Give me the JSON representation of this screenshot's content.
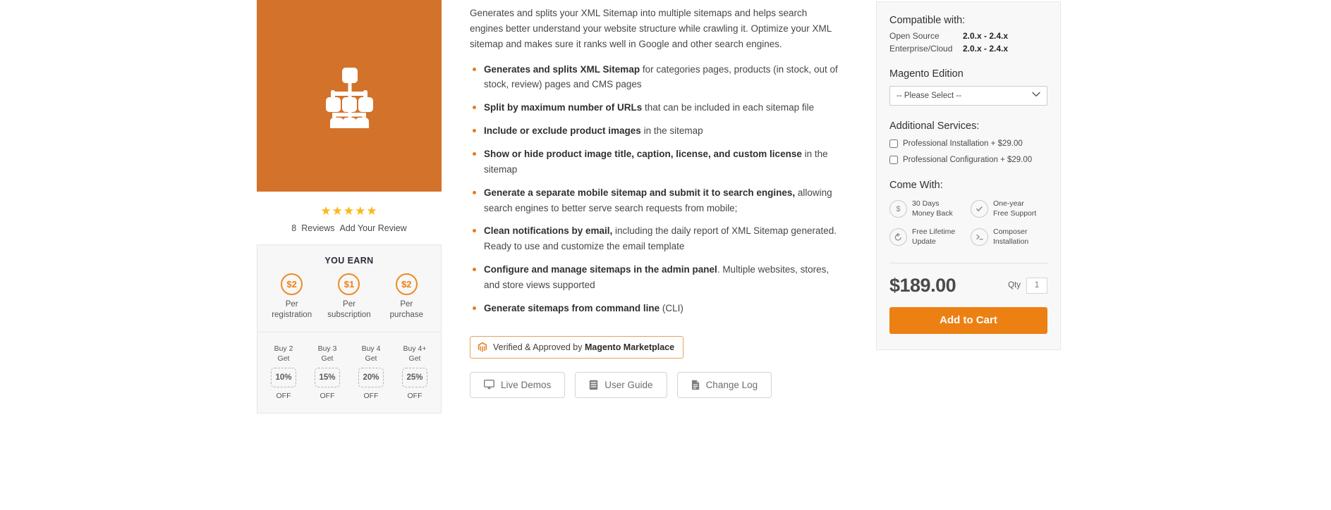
{
  "product": {
    "image_alt": "sitemap-tree-graphic",
    "image_bg": "#d3722a",
    "rating": {
      "stars_filled": 5,
      "stars_total": 5,
      "star_glyph": "★",
      "count_label": "8",
      "reviews_label": "Reviews",
      "add_review_label": "Add Your Review"
    }
  },
  "earn": {
    "title": "YOU EARN",
    "items": [
      {
        "amount": "$2",
        "line1": "Per",
        "line2": "registration"
      },
      {
        "amount": "$1",
        "line1": "Per",
        "line2": "subscription"
      },
      {
        "amount": "$2",
        "line1": "Per",
        "line2": "purchase"
      }
    ],
    "tiers": [
      {
        "buy": "Buy 2",
        "get": "Get",
        "percent": "10%",
        "off": "OFF"
      },
      {
        "buy": "Buy 3",
        "get": "Get",
        "percent": "15%",
        "off": "OFF"
      },
      {
        "buy": "Buy 4",
        "get": "Get",
        "percent": "20%",
        "off": "OFF"
      },
      {
        "buy": "Buy 4+",
        "get": "Get",
        "percent": "25%",
        "off": "OFF"
      }
    ]
  },
  "description": {
    "intro": "Generates and splits your XML Sitemap into multiple sitemaps and helps search engines better understand your website structure while crawling it. Optimize your XML sitemap and makes sure it ranks well in Google and other search engines.",
    "features": [
      {
        "bold": "Generates and splits XML Sitemap",
        "rest": " for categories pages, products (in stock, out of stock, review) pages and CMS pages"
      },
      {
        "bold": "Split by maximum number of URLs",
        "rest": " that can be included in each sitemap file"
      },
      {
        "bold": "Include or exclude product images",
        "rest": " in the sitemap"
      },
      {
        "bold": "Show or hide product image title, caption, license, and custom license",
        "rest": " in the sitemap"
      },
      {
        "bold": "Generate a separate mobile sitemap and submit it to search engines,",
        "rest": " allowing search engines to better serve search requests from mobile;"
      },
      {
        "bold": "Clean notifications by email,",
        "rest": " including the daily report of XML Sitemap generated. Ready to use and customize the email template"
      },
      {
        "bold": "Configure and manage sitemaps in the admin panel",
        "rest": ". Multiple websites, stores, and store views supported"
      },
      {
        "bold": "Generate sitemaps from command line",
        "rest": " (CLI)"
      }
    ]
  },
  "verified": {
    "icon": "magento-logo-icon",
    "prefix": "Verified & Approved by ",
    "brand": "Magento Marketplace",
    "border_color": "#e0a458"
  },
  "doc_buttons": [
    {
      "icon": "monitor-icon",
      "label": "Live Demos"
    },
    {
      "icon": "book-icon",
      "label": "User Guide"
    },
    {
      "icon": "document-icon",
      "label": "Change Log"
    }
  ],
  "sidebar": {
    "compatible_title": "Compatible with:",
    "compatible_rows": [
      {
        "label": "Open Source",
        "value": "2.0.x - 2.4.x"
      },
      {
        "label": "Enterprise/Cloud",
        "value": "2.0.x - 2.4.x"
      }
    ],
    "edition_title": "Magento Edition",
    "edition_selected": "-- Please Select --",
    "edition_options": [
      "-- Please Select --"
    ],
    "services_title": "Additional Services:",
    "services": [
      {
        "label": "Professional Installation + $29.00",
        "checked": false
      },
      {
        "label": "Professional Configuration + $29.00",
        "checked": false
      }
    ],
    "come_with_title": "Come With:",
    "come_with": [
      {
        "icon": "dollar-icon",
        "line1": "30 Days",
        "line2": "Money Back"
      },
      {
        "icon": "check-icon",
        "line1": "One-year",
        "line2": "Free Support"
      },
      {
        "icon": "undo-icon",
        "line1": "Free Lifetime",
        "line2": "Update"
      },
      {
        "icon": "terminal-icon",
        "line1": "Composer",
        "line2": "Installation"
      }
    ],
    "price": "$189.00",
    "qty_label": "Qty",
    "qty_value": "1",
    "add_to_cart_label": "Add to Cart",
    "accent_color": "#ec8013"
  }
}
